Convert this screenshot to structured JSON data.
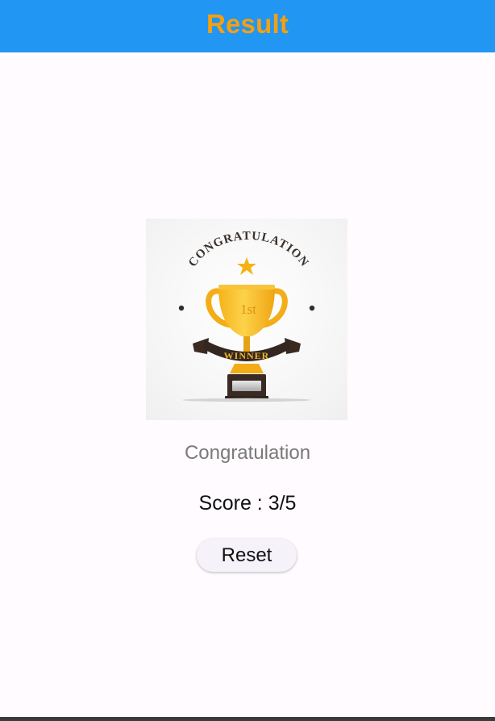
{
  "app_bar": {
    "title": "Result",
    "background_color": "#2196f3",
    "title_color": "#f5a00f"
  },
  "result": {
    "image": {
      "icon": "trophy-winner-icon",
      "arc_text": "CONGRATULATION",
      "ribbon_text": "WINNER",
      "cup_text": "1st"
    },
    "message": "Congratulation",
    "score_label": "Score : 3/5",
    "reset_label": "Reset"
  }
}
